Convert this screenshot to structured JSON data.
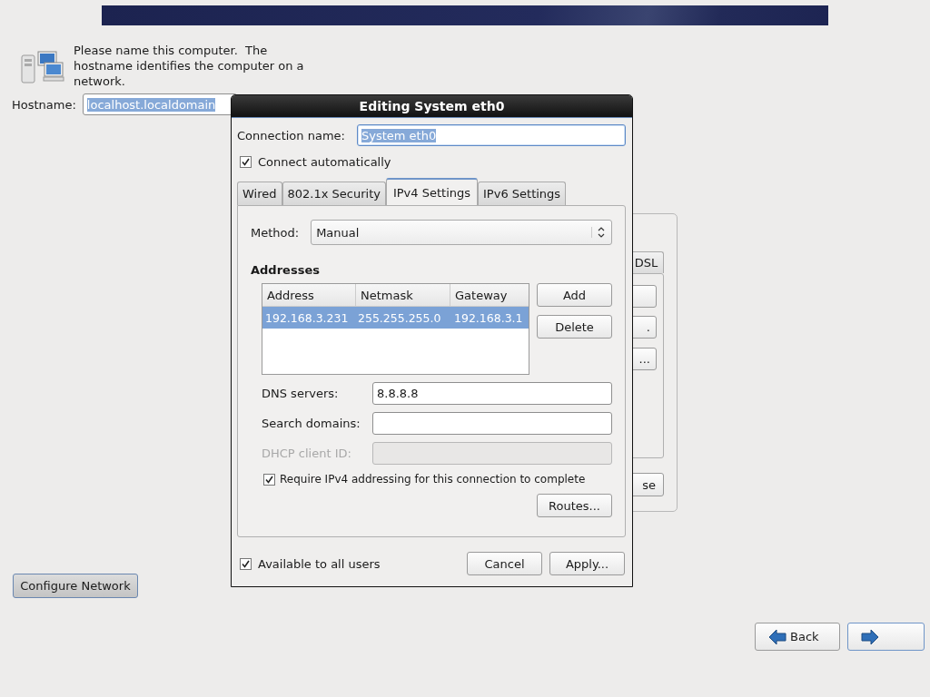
{
  "intro": {
    "text": "Please name this computer.  The hostname identifies the computer on a network."
  },
  "hostname": {
    "label": "Hostname:",
    "value": "localhost.localdomain",
    "text_selected": true
  },
  "background_window": {
    "tab": "DSL",
    "buttons": [
      {
        "kind": "blank"
      },
      {
        "kind": "text",
        "label": "."
      },
      {
        "kind": "text",
        "label": "..."
      }
    ],
    "bottom_button": "se"
  },
  "dialog": {
    "title": "Editing System eth0",
    "connection_name": {
      "label": "Connection name:",
      "value": "System eth0",
      "text_selected": true
    },
    "connect_automatically": {
      "label": "Connect automatically",
      "checked": true
    },
    "tabs": [
      {
        "label": "Wired",
        "selected": false
      },
      {
        "label": "802.1x Security",
        "selected": false
      },
      {
        "label": "IPv4 Settings",
        "selected": true
      },
      {
        "label": "IPv6 Settings",
        "selected": false
      }
    ],
    "method": {
      "label": "Method:",
      "value": "Manual"
    },
    "addresses": {
      "heading": "Addresses",
      "columns": [
        "Address",
        "Netmask",
        "Gateway"
      ],
      "rows": [
        {
          "cells": [
            "192.168.3.231",
            "255.255.255.0",
            "192.168.3.1"
          ],
          "selected": true
        }
      ],
      "buttons": [
        "Add",
        "Delete"
      ]
    },
    "fields": [
      {
        "label": "DNS servers:",
        "value": "8.8.8.8",
        "disabled": false
      },
      {
        "label": "Search domains:",
        "disabled": false
      },
      {
        "label": "DHCP client ID:",
        "disabled": true
      }
    ],
    "require_ipv4": {
      "label": "Require IPv4 addressing for this connection to complete",
      "checked": true
    },
    "routes_button": "Routes...",
    "available_to_all": {
      "label": "Available to all users",
      "checked": true
    },
    "buttons": [
      "Cancel",
      "Apply..."
    ]
  },
  "configure_button": "Configure Network",
  "nav": [
    {
      "kind": "back",
      "label": "Back"
    },
    {
      "kind": "next"
    }
  ]
}
